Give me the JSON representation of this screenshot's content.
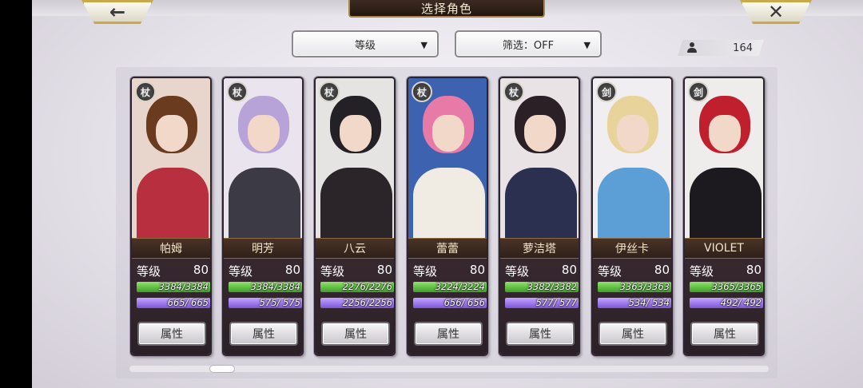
{
  "header": {
    "title": "选择角色",
    "back_icon": "←",
    "close_icon": "✕"
  },
  "controls": {
    "sort_label": "等级",
    "filter_label": "筛选：OFF",
    "caret": "▼",
    "character_count": "164"
  },
  "card_common": {
    "level_label": "等级",
    "attr_button": "属性"
  },
  "characters": [
    {
      "name": "帕姆",
      "class": "杖",
      "level": "80",
      "hp": "3384/3384",
      "sp": "665/  665",
      "bg": "#e8d6cc",
      "hair": "#6b3b1f",
      "body": "#b83040"
    },
    {
      "name": "明芳",
      "class": "杖",
      "level": "80",
      "hp": "3384/3384",
      "sp": "575/  575",
      "bg": "#e9e4ee",
      "hair": "#b7a3d8",
      "body": "#3c3b45"
    },
    {
      "name": "八云",
      "class": "杖",
      "level": "80",
      "hp": "2276/2276",
      "sp": "2256/2256",
      "bg": "#e6e3e3",
      "hair": "#232126",
      "body": "#2b252a"
    },
    {
      "name": "蕾蕾",
      "class": "杖",
      "level": "80",
      "hp": "3224/3224",
      "sp": "656/  656",
      "bg": "#3d62b0",
      "hair": "#e77aa6",
      "body": "#f0ece4"
    },
    {
      "name": "萝洁塔",
      "class": "杖",
      "level": "80",
      "hp": "3382/3382",
      "sp": "577/  577",
      "bg": "#e9e3e6",
      "hair": "#2a2025",
      "body": "#2b3050"
    },
    {
      "name": "伊丝卡",
      "class": "剑",
      "level": "80",
      "hp": "3363/3363",
      "sp": "534/  534",
      "bg": "#f0eef0",
      "hair": "#e8d49a",
      "body": "#5c9fd6"
    },
    {
      "name": "VIOLET",
      "class": "剑",
      "level": "80",
      "hp": "3365/3365",
      "sp": "492/  492",
      "bg": "#efecec",
      "hair": "#c0202e",
      "body": "#1c1a1f"
    }
  ]
}
